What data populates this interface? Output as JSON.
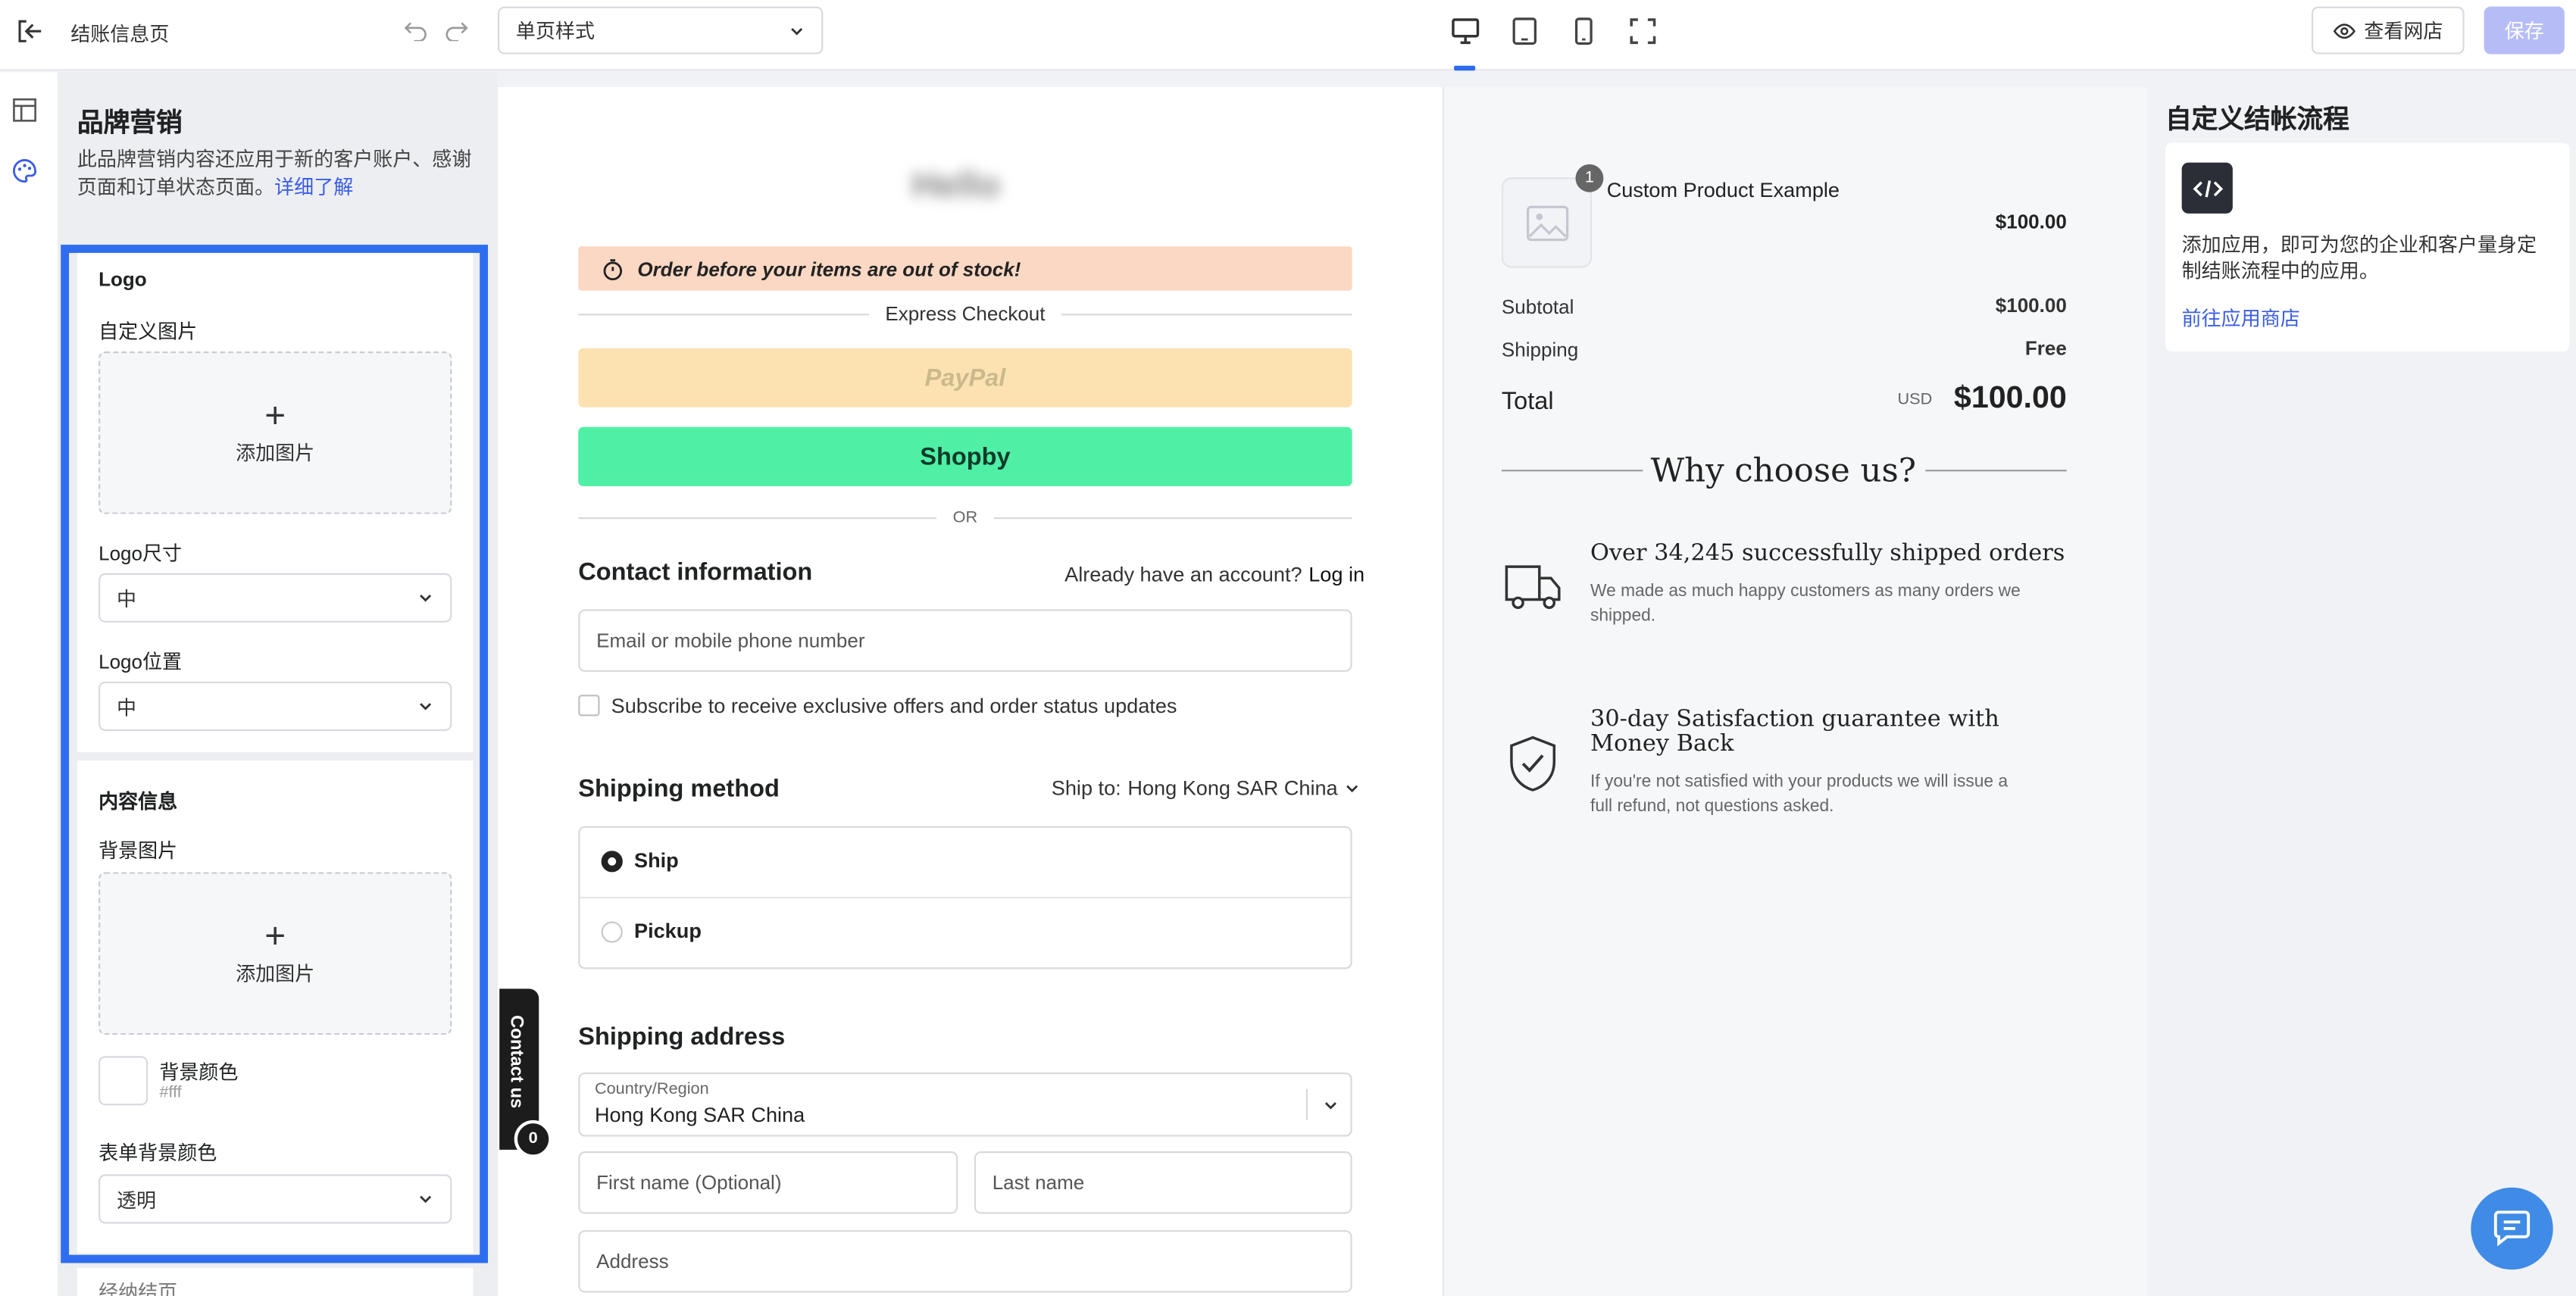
{
  "topbar": {
    "page_title": "结账信息页",
    "template_select": "单页样式",
    "view_store": "查看网店",
    "save": "保存"
  },
  "panel": {
    "title": "品牌营销",
    "description": "此品牌营销内容还应用于新的客户账户、感谢页面和订单状态页面。",
    "learn_more": "详细了解",
    "logo_section": "Logo",
    "custom_image": "自定义图片",
    "add_image": "添加图片",
    "logo_size_label": "Logo尺寸",
    "logo_size_value": "中",
    "logo_position_label": "Logo位置",
    "logo_position_value": "中",
    "content_section": "内容信息",
    "bg_image_label": "背景图片",
    "add_image_2": "添加图片",
    "bg_color_label": "背景颜色",
    "bg_color_value": "#fff",
    "form_bg_label": "表单背景颜色",
    "form_bg_value": "透明",
    "next_section_partial": "经纳结页"
  },
  "checkout": {
    "logo_text": "Hello",
    "urgency": "Order before your items are out of stock!",
    "express_checkout": "Express Checkout",
    "paypal": "PayPal",
    "shopby": "Shopby",
    "or": "OR",
    "contact_title": "Contact information",
    "have_account": "Already have an account?",
    "log_in": "Log in",
    "email_placeholder": "Email or mobile phone number",
    "subscribe": "Subscribe to receive exclusive offers and order status updates",
    "shipping_method_title": "Shipping method",
    "ship_to_label": "Ship to:",
    "ship_to_value": "Hong Kong SAR China",
    "opt_ship": "Ship",
    "opt_pickup": "Pickup",
    "shipping_address_title": "Shipping address",
    "country_label": "Country/Region",
    "country_value": "Hong Kong SAR China",
    "first_name": "First name (Optional)",
    "last_name": "Last name",
    "address": "Address",
    "contact_us": "Contact us",
    "contact_badge": "0"
  },
  "summary": {
    "qty_badge": "1",
    "product_name": "Custom Product Example",
    "product_price": "$100.00",
    "subtotal_label": "Subtotal",
    "subtotal_value": "$100.00",
    "shipping_label": "Shipping",
    "shipping_value": "Free",
    "total_label": "Total",
    "currency": "USD",
    "total_value": "$100.00",
    "why_title": "Why choose us?",
    "benefit1_title": "Over 34,245 successfully shipped orders",
    "benefit1_desc": "We made as much happy customers as many orders we shipped.",
    "benefit2_title": "30-day Satisfaction guarantee with Money Back",
    "benefit2_desc": "If you're not satisfied with your products we will issue a full refund, not questions asked."
  },
  "apps": {
    "title": "自定义结帐流程",
    "description": "添加应用，即可为您的企业和客户量身定制结账流程中的应用。",
    "link": "前往应用商店"
  },
  "colors": {
    "accent": "#2f6df0",
    "link": "#3a5ce5",
    "save_disabled": "#b6bdf6",
    "urgency_bg": "#fbd8c4",
    "paypal_bg": "#fbe2b0",
    "shopby_bg": "#4ff0a5",
    "chat_bg": "#3f8be6"
  }
}
